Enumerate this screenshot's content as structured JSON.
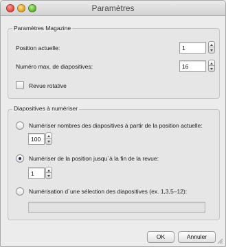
{
  "window": {
    "title": "Paramètres"
  },
  "magazine": {
    "legend": "Paramètres Magazine",
    "position_label": "Position actuelle:",
    "position_value": "1",
    "max_label": "Numéro max. de diapositives:",
    "max_value": "16",
    "rotative_label": "Revue rotative",
    "rotative_checked": false
  },
  "scan": {
    "legend": "Diapositives à numériser",
    "option1_label": "Numériser nombres des diapositives à partir de la position actuelle:",
    "option1_value": "100",
    "option1_selected": false,
    "option2_label": "Numériser de la position jusqu´à la fin de la revue:",
    "option2_value": "1",
    "option2_selected": true,
    "option3_label": "Numérisation d´une sélection des diapositives (ex. 1,3,5–12):",
    "option3_value": "",
    "option3_selected": false
  },
  "buttons": {
    "ok_label": "OK",
    "cancel_label": "Annuler"
  }
}
